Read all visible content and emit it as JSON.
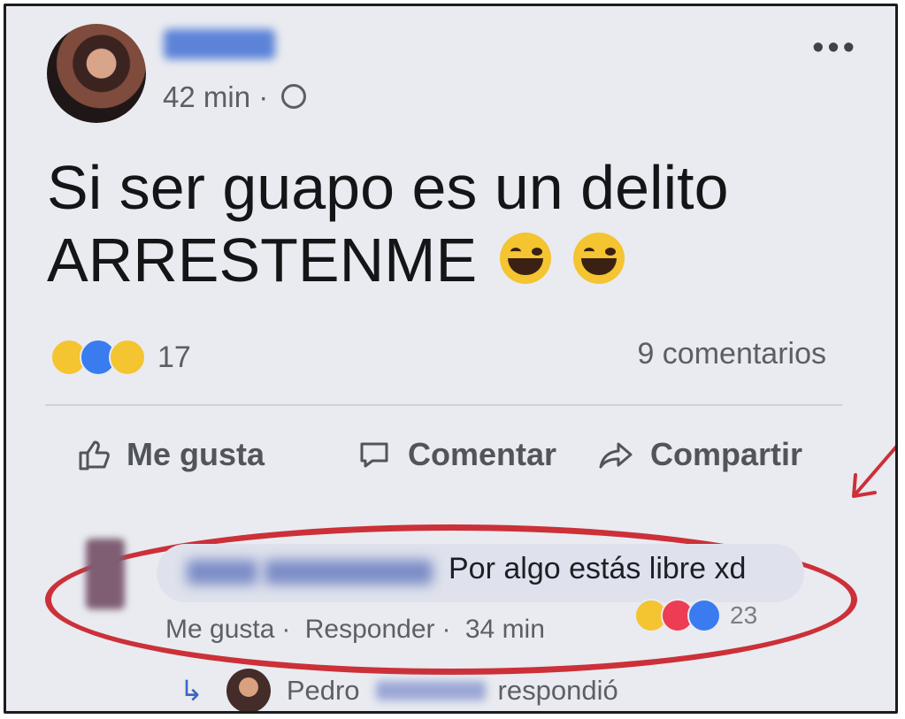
{
  "post": {
    "time": "42 min",
    "separator": "·",
    "more_label": "•••",
    "text_line1": "Si ser guapo es un delito",
    "text_line2": "ARRESTENME",
    "reaction_count": "17",
    "comments_label": "9 comentarios",
    "icons": [
      "globe-icon",
      "more-icon",
      "haha-reaction-icon",
      "like-reaction-icon",
      "wow-reaction-icon",
      "laughing-crying-emoji-icon"
    ]
  },
  "actions": {
    "like": "Me gusta",
    "comment": "Comentar",
    "share": "Compartir"
  },
  "comment": {
    "text": "Por algo estás libre xd",
    "like": "Me gusta",
    "reply": "Responder",
    "time": "34 min",
    "reaction_count": "23",
    "icons": [
      "haha-reaction-icon",
      "love-reaction-icon",
      "like-reaction-icon"
    ]
  },
  "reply": {
    "author": "Pedro",
    "verb": "respondió",
    "icon": "reply-arrow-icon"
  },
  "annotation": {
    "color": "#cc3038"
  }
}
